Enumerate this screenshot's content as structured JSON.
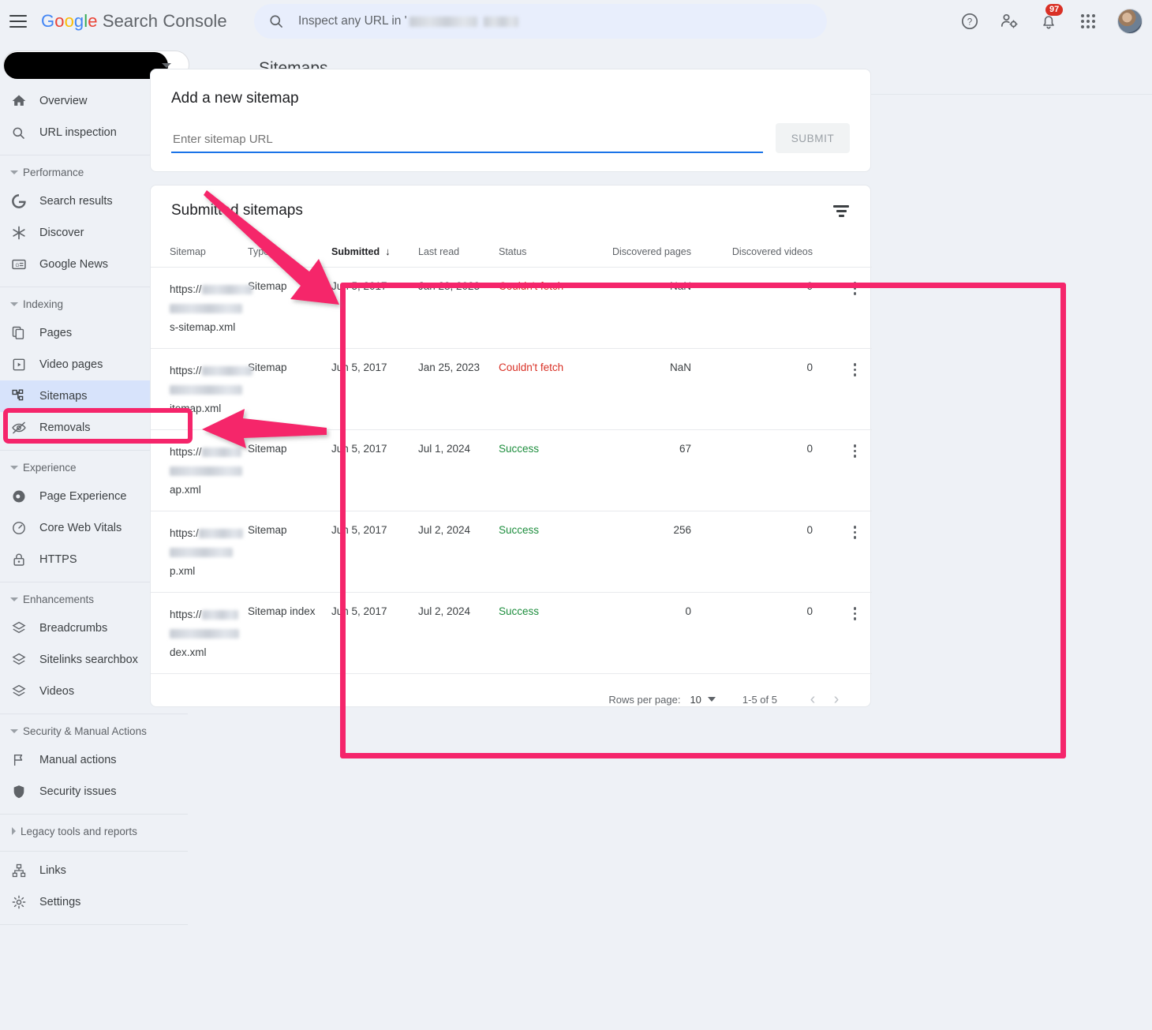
{
  "topbar": {
    "menu_icon": "hamburger-menu-icon",
    "brand": {
      "google": "Google",
      "product": "Search Console"
    },
    "search": {
      "icon": "search-icon",
      "placeholder": "Inspect any URL in '"
    },
    "icons": {
      "help": "help-circle-icon",
      "users": "manage-users-icon",
      "notifications": "notifications-bell-icon",
      "apps": "google-apps-grid-icon",
      "account": "account-avatar"
    },
    "notification_count": "97"
  },
  "sidebar": {
    "property_selector": {
      "value": "",
      "caret": "chevron-down-icon"
    },
    "items": [
      {
        "label": "Overview",
        "icon": "home-icon",
        "type": "item"
      },
      {
        "label": "URL inspection",
        "icon": "search-icon",
        "type": "item"
      },
      {
        "label": "Performance",
        "icon": "chevron-down-icon",
        "type": "section",
        "expanded": true
      },
      {
        "label": "Search results",
        "icon": "google-g-icon",
        "type": "item"
      },
      {
        "label": "Discover",
        "icon": "discover-asterisk-icon",
        "type": "item"
      },
      {
        "label": "Google News",
        "icon": "google-news-icon",
        "type": "item"
      },
      {
        "label": "Indexing",
        "icon": "chevron-down-icon",
        "type": "section",
        "expanded": true
      },
      {
        "label": "Pages",
        "icon": "pages-copy-icon",
        "type": "item"
      },
      {
        "label": "Video pages",
        "icon": "video-pages-icon",
        "type": "item"
      },
      {
        "label": "Sitemaps",
        "icon": "sitemaps-tree-icon",
        "type": "item",
        "active": true
      },
      {
        "label": "Removals",
        "icon": "eye-off-icon",
        "type": "item"
      },
      {
        "label": "Experience",
        "icon": "chevron-down-icon",
        "type": "section",
        "expanded": true
      },
      {
        "label": "Page Experience",
        "icon": "page-experience-icon",
        "type": "item"
      },
      {
        "label": "Core Web Vitals",
        "icon": "core-web-vitals-gauge-icon",
        "type": "item"
      },
      {
        "label": "HTTPS",
        "icon": "lock-icon",
        "type": "item"
      },
      {
        "label": "Enhancements",
        "icon": "chevron-down-icon",
        "type": "section",
        "expanded": true
      },
      {
        "label": "Breadcrumbs",
        "icon": "layers-icon",
        "type": "item"
      },
      {
        "label": "Sitelinks searchbox",
        "icon": "layers-icon",
        "type": "item"
      },
      {
        "label": "Videos",
        "icon": "layers-icon",
        "type": "item"
      },
      {
        "label": "Security & Manual Actions",
        "icon": "chevron-down-icon",
        "type": "section",
        "expanded": true
      },
      {
        "label": "Manual actions",
        "icon": "flag-icon",
        "type": "item"
      },
      {
        "label": "Security issues",
        "icon": "shield-icon",
        "type": "item"
      },
      {
        "label": "Legacy tools and reports",
        "icon": "chevron-right-icon",
        "type": "section",
        "expanded": false
      },
      {
        "label": "Links",
        "icon": "links-tree-icon",
        "type": "item"
      },
      {
        "label": "Settings",
        "icon": "gear-icon",
        "type": "item"
      }
    ]
  },
  "page": {
    "title": "Sitemaps"
  },
  "add_sitemap": {
    "title": "Add a new sitemap",
    "input_placeholder": "Enter sitemap URL",
    "input_value": "",
    "submit_label": "SUBMIT"
  },
  "submitted": {
    "title": "Submitted sitemaps",
    "filter_icon": "filter-list-icon",
    "columns": [
      "Sitemap",
      "Type",
      "Submitted",
      "Last read",
      "Status",
      "Discovered pages",
      "Discovered videos"
    ],
    "sort_column": "Submitted",
    "sort_direction": "desc",
    "sort_arrow": "↓",
    "rows": [
      {
        "url_prefix": "https://",
        "url_suffix": "s-sitemap.xml",
        "type": "Sitemap",
        "submitted": "Jun 5, 2017",
        "last_read": "Jan 28, 2023",
        "status": "Couldn't fetch",
        "status_kind": "error",
        "discovered_pages": "NaN",
        "discovered_videos": "0",
        "menu_icon": "more-vert-icon"
      },
      {
        "url_prefix": "https://",
        "url_suffix": "itemap.xml",
        "type": "Sitemap",
        "submitted": "Jun 5, 2017",
        "last_read": "Jan 25, 2023",
        "status": "Couldn't fetch",
        "status_kind": "error",
        "discovered_pages": "NaN",
        "discovered_videos": "0",
        "menu_icon": "more-vert-icon"
      },
      {
        "url_prefix": "https://",
        "url_suffix": "ap.xml",
        "type": "Sitemap",
        "submitted": "Jun 5, 2017",
        "last_read": "Jul 1, 2024",
        "status": "Success",
        "status_kind": "ok",
        "discovered_pages": "67",
        "discovered_videos": "0",
        "menu_icon": "more-vert-icon"
      },
      {
        "url_prefix": "https:/",
        "url_suffix": "p.xml",
        "type": "Sitemap",
        "submitted": "Jun 5, 2017",
        "last_read": "Jul 2, 2024",
        "status": "Success",
        "status_kind": "ok",
        "discovered_pages": "256",
        "discovered_videos": "0",
        "menu_icon": "more-vert-icon"
      },
      {
        "url_prefix": "https://",
        "url_suffix": "dex.xml",
        "type": "Sitemap index",
        "submitted": "Jun 5, 2017",
        "last_read": "Jul 2, 2024",
        "status": "Success",
        "status_kind": "ok",
        "discovered_pages": "0",
        "discovered_videos": "0",
        "menu_icon": "more-vert-icon"
      }
    ],
    "pagination": {
      "rows_per_page_label": "Rows per page:",
      "rows_per_page_value": "10",
      "range": "1-5 of 5",
      "prev_icon": "chevron-left-icon",
      "next_icon": "chevron-right-icon"
    }
  },
  "annotations": {
    "highlight_color": "#f5256b",
    "arrow_to_table": "arrow-diagonal-down-right",
    "arrow_to_sitemaps": "arrow-left",
    "box_table": "highlight-box-table",
    "box_sitemaps_nav": "highlight-box-sitemaps-nav"
  }
}
